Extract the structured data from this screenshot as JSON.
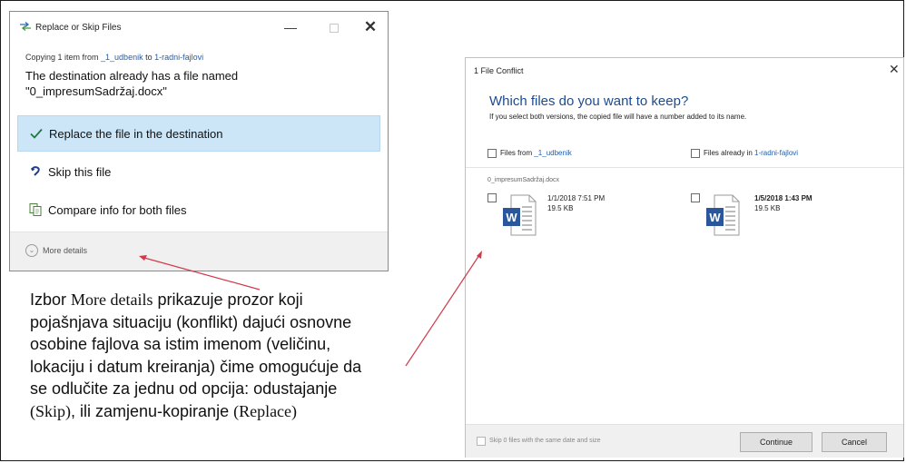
{
  "replace_dialog": {
    "title": "Replace or Skip Files",
    "copying_prefix": "Copying 1 item from ",
    "source_folder": "_1_udbenik",
    "copying_to": " to ",
    "dest_folder": "1-radni-fajlovi",
    "message_line1": "The destination already has a file named",
    "message_line2": "\"0_impresumSadržaj.docx\"",
    "options": {
      "replace": "Replace the file in the destination",
      "skip": "Skip this file",
      "compare": "Compare info for both files"
    },
    "more_details": "More details"
  },
  "annotation": {
    "line1_a": "Izbor ",
    "line1_b": "More details",
    "line1_c": " prikazuje prozor koji",
    "line2": "pojašnjava situaciju (konflikt) dajući osnovne",
    "line3": "osobine fajlova sa istim imenom (veličinu,",
    "line4": "lokaciju i datum kreiranja) čime omogućuje da",
    "line5": "se odlučite za jednu od opcija: odustajanje",
    "line6_a": "(Skip)",
    "line6_b": ", ili zamjenu-kopiranje ",
    "line6_c": "(Replace)"
  },
  "conflict_dialog": {
    "title": "1 File Conflict",
    "heading": "Which files do you want to keep?",
    "subnote": "If you select both versions, the copied file will have a number added to its name.",
    "col_source_prefix": "Files from ",
    "col_source_folder": "_1_udbenik",
    "col_dest_prefix": "Files already in ",
    "col_dest_folder": "1-radni-fajlovi",
    "file_name": "0_impresumSadržaj.docx",
    "source_file": {
      "date": "1/1/2018 7:51 PM",
      "size": "19.5 KB"
    },
    "dest_file": {
      "date": "1/5/2018 1:43 PM",
      "size": "19.5 KB"
    },
    "skip_same_label": "Skip 0 files with the same date and size",
    "continue_label": "Continue",
    "cancel_label": "Cancel"
  },
  "colors": {
    "selected_option_bg": "#cce6f8",
    "heading_blue": "#1d4b8f",
    "link_blue": "#1f5fb0",
    "arrow_red": "#d03a4a",
    "word_blue": "#2b579a"
  },
  "icons": [
    "transfer-icon",
    "minimize-icon",
    "maximize-icon",
    "close-icon",
    "checkmark-icon",
    "skip-arrow-icon",
    "compare-icon",
    "chevron-down-icon",
    "word-document-icon"
  ]
}
